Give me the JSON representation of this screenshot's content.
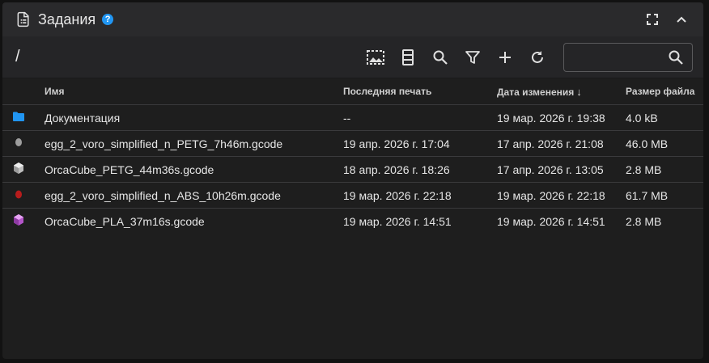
{
  "header": {
    "title": "Задания",
    "help": "?"
  },
  "path": "/",
  "search": {
    "value": "",
    "placeholder": ""
  },
  "columns": {
    "name": "Имя",
    "last_print": "Последняя печать",
    "modified": "Дата изменения",
    "size": "Размер файла"
  },
  "files": [
    {
      "icon": "folder-icon",
      "color": "#2196f3",
      "name": "Документация",
      "last_print": "--",
      "modified": "19 мар. 2026 г. 19:38",
      "size": "4.0 kB"
    },
    {
      "icon": "gcode-thumbnail-icon",
      "color": "#9e9e9e",
      "name": "egg_2_voro_simplified_n_PETG_7h46m.gcode",
      "last_print": "19 апр. 2026 г. 17:04",
      "modified": "17 апр. 2026 г. 21:08",
      "size": "46.0 MB"
    },
    {
      "icon": "cube-icon",
      "color": "#d0d0d0",
      "name": "OrcaCube_PETG_44m36s.gcode",
      "last_print": "18 апр. 2026 г. 18:26",
      "modified": "17 апр. 2026 г. 13:05",
      "size": "2.8 MB"
    },
    {
      "icon": "gcode-thumbnail-icon",
      "color": "#b71c1c",
      "name": "egg_2_voro_simplified_n_ABS_10h26m.gcode",
      "last_print": "19 мар. 2026 г. 22:18",
      "modified": "19 мар. 2026 г. 22:18",
      "size": "61.7 MB"
    },
    {
      "icon": "cube-icon",
      "color": "#c264d8",
      "name": "OrcaCube_PLA_37m16s.gcode",
      "last_print": "19 мар. 2026 г. 14:51",
      "modified": "19 мар. 2026 г. 14:51",
      "size": "2.8 MB"
    }
  ]
}
